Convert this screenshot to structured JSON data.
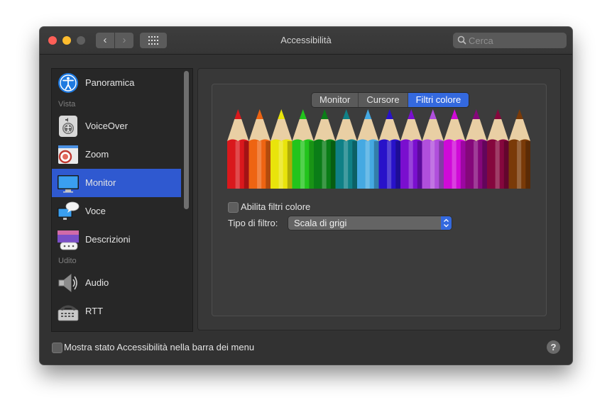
{
  "window": {
    "title": "Accessibilità",
    "search_placeholder": "Cerca"
  },
  "sidebar": {
    "sections": [
      "Vista",
      "Udito"
    ],
    "items": [
      {
        "label": "Panoramica",
        "icon": "accessibility-icon"
      },
      {
        "label": "VoiceOver",
        "icon": "voiceover-icon"
      },
      {
        "label": "Zoom",
        "icon": "zoom-icon"
      },
      {
        "label": "Monitor",
        "icon": "monitor-icon",
        "selected": true
      },
      {
        "label": "Voce",
        "icon": "speech-icon"
      },
      {
        "label": "Descrizioni",
        "icon": "descriptions-icon"
      },
      {
        "label": "Audio",
        "icon": "speaker-icon"
      },
      {
        "label": "RTT",
        "icon": "rtt-phone-icon"
      }
    ]
  },
  "tabs": [
    {
      "label": "Monitor",
      "active": false
    },
    {
      "label": "Cursore",
      "active": false
    },
    {
      "label": "Filtri colore",
      "active": true
    }
  ],
  "filters": {
    "enable_label": "Abilita filtri colore",
    "enable_checked": false,
    "type_label": "Tipo di filtro:",
    "type_value": "Scala di grigi"
  },
  "pencil_colors": [
    "#d9181c",
    "#ee6412",
    "#e9e40b",
    "#22c41c",
    "#0a7d17",
    "#0f8086",
    "#45a9e2",
    "#2812c9",
    "#7a0fcf",
    "#b04fdc",
    "#d00ad8",
    "#85077a",
    "#85073d",
    "#7a3a08"
  ],
  "footer": {
    "show_status_label": "Mostra stato Accessibilità nella barra dei menu",
    "show_status_checked": false
  },
  "colors": {
    "accent": "#2f59d0",
    "window_bg": "#323232"
  }
}
